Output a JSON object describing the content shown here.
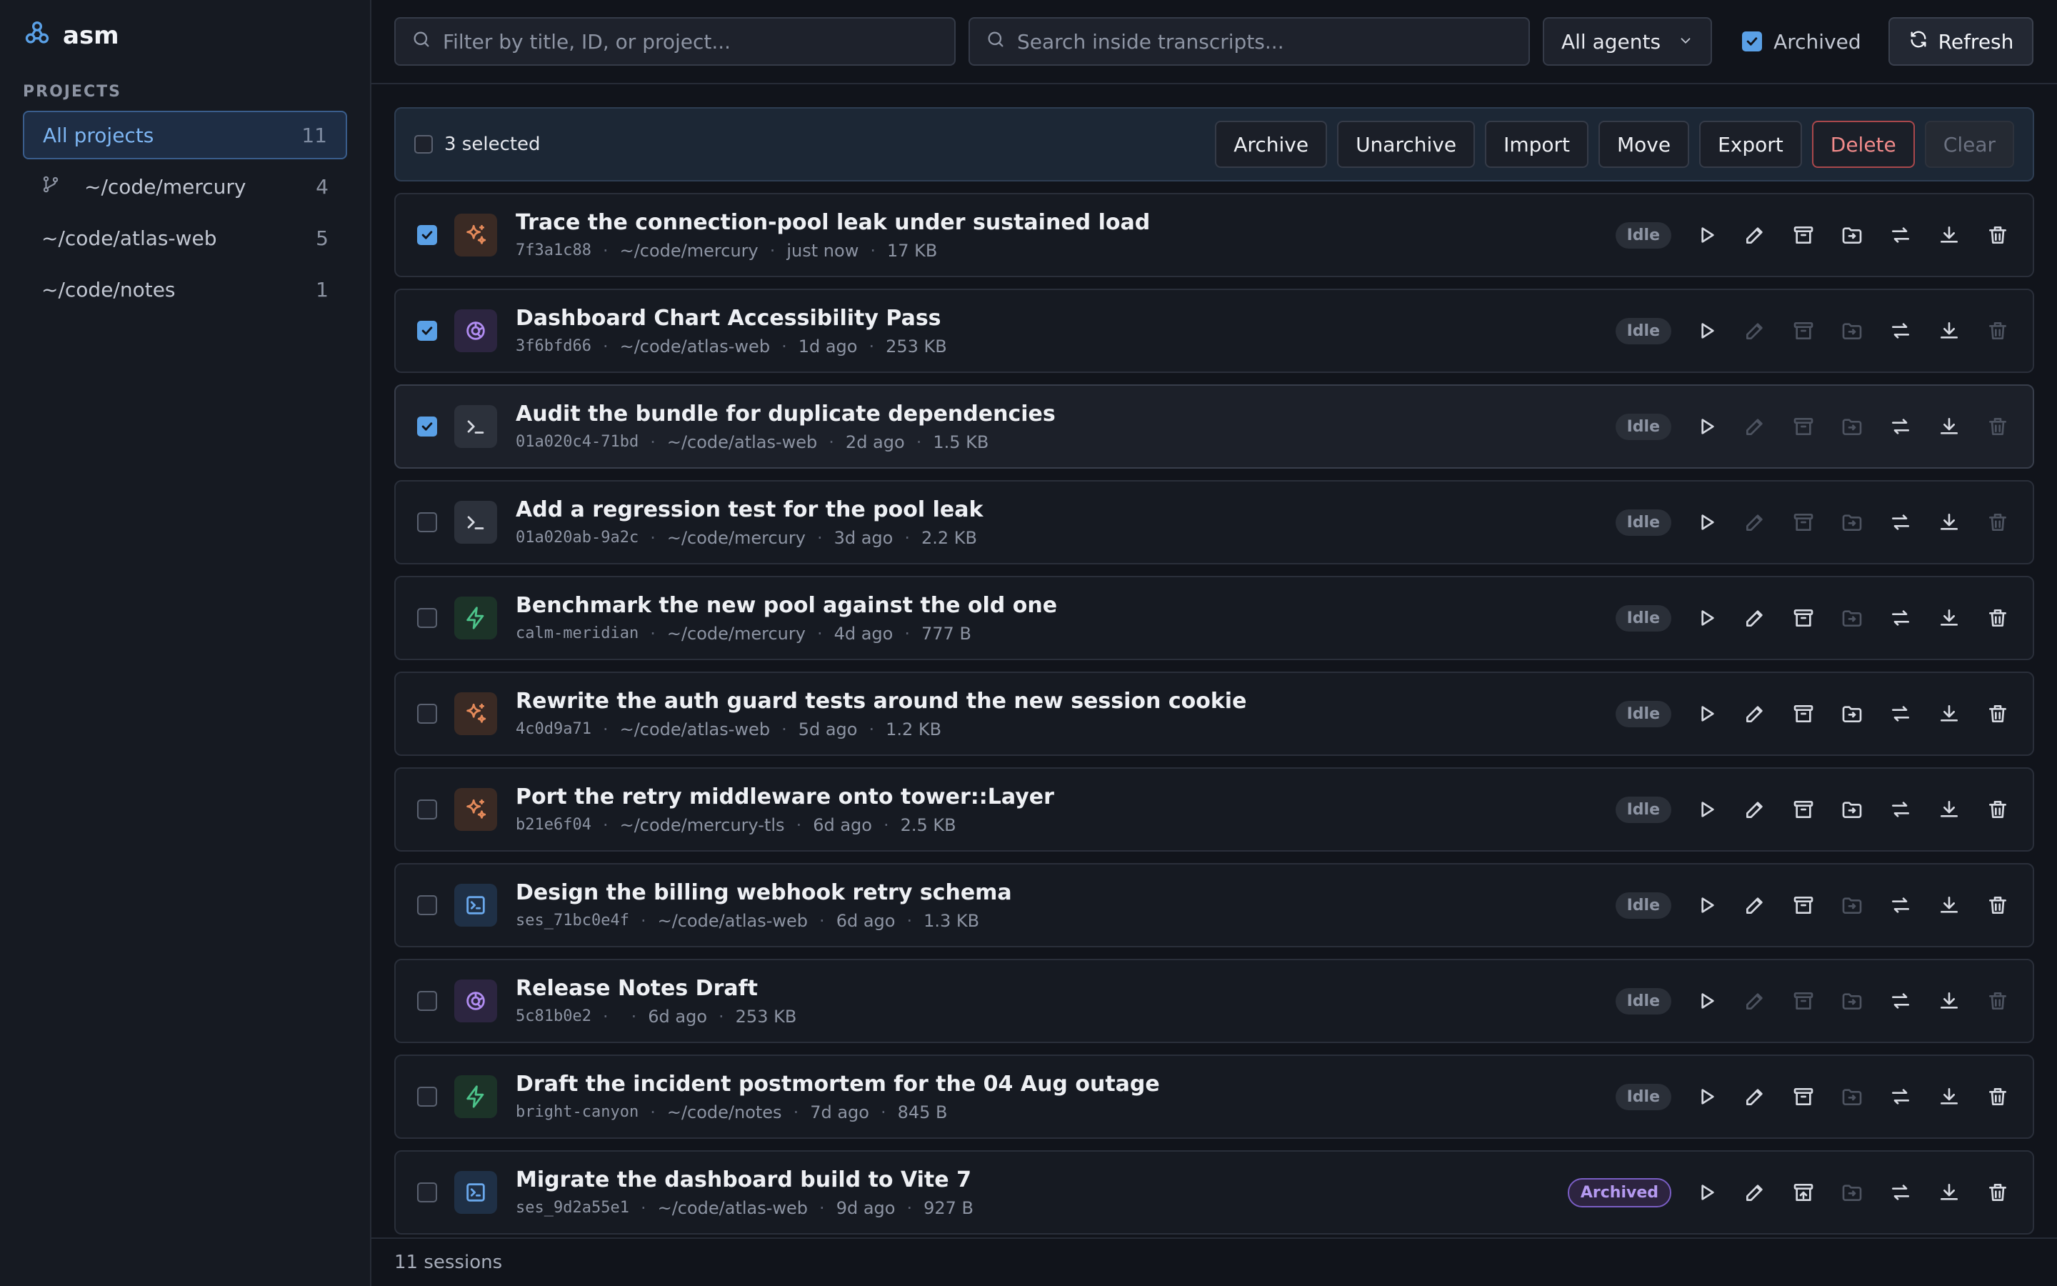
{
  "app": {
    "name": "asm"
  },
  "sidebar": {
    "section_label": "PROJECTS",
    "items": [
      {
        "label": "All projects",
        "count": "11",
        "active": true
      },
      {
        "label": "~/code/mercury",
        "count": "4",
        "icon": "git-branch-icon"
      },
      {
        "label": "~/code/atlas-web",
        "count": "5"
      },
      {
        "label": "~/code/notes",
        "count": "1"
      }
    ]
  },
  "toolbar": {
    "filter_placeholder": "Filter by title, ID, or project...",
    "search_placeholder": "Search inside transcripts...",
    "agent_select": "All agents",
    "archived_label": "Archived",
    "archived_checked": true,
    "refresh_label": "Refresh"
  },
  "selection": {
    "text": "3 selected",
    "actions": {
      "archive": "Archive",
      "unarchive": "Unarchive",
      "import": "Import",
      "move": "Move",
      "export": "Export",
      "delete": "Delete",
      "clear": "Clear"
    }
  },
  "sessions": [
    {
      "title": "Trace the connection-pool leak under sustained load",
      "id": "7f3a1c88",
      "project": "~/code/mercury",
      "age": "just now",
      "size": "17 KB",
      "status": "Idle",
      "agent": "claude",
      "selected": true,
      "dim": []
    },
    {
      "title": "Dashboard Chart Accessibility Pass",
      "id": "3f6bfd66",
      "project": "~/code/atlas-web",
      "age": "1d ago",
      "size": "253 KB",
      "status": "Idle",
      "agent": "openai",
      "selected": true,
      "dim": [
        "edit",
        "archive",
        "move",
        "delete"
      ]
    },
    {
      "title": "Audit the bundle for duplicate dependencies",
      "id": "01a020c4-71bd",
      "project": "~/code/atlas-web",
      "age": "2d ago",
      "size": "1.5 KB",
      "status": "Idle",
      "agent": "terminal",
      "selected": true,
      "highlight": true,
      "dim": [
        "edit",
        "archive",
        "move",
        "delete"
      ]
    },
    {
      "title": "Add a regression test for the pool leak",
      "id": "01a020ab-9a2c",
      "project": "~/code/mercury",
      "age": "3d ago",
      "size": "2.2 KB",
      "status": "Idle",
      "agent": "terminal",
      "selected": false,
      "dim": [
        "edit",
        "archive",
        "move",
        "delete"
      ]
    },
    {
      "title": "Benchmark the new pool against the old one",
      "id": "calm-meridian",
      "project": "~/code/mercury",
      "age": "4d ago",
      "size": "777 B",
      "status": "Idle",
      "agent": "bolt",
      "selected": false,
      "dim": [
        "move"
      ]
    },
    {
      "title": "Rewrite the auth guard tests around the new session cookie",
      "id": "4c0d9a71",
      "project": "~/code/atlas-web",
      "age": "5d ago",
      "size": "1.2 KB",
      "status": "Idle",
      "agent": "claude",
      "selected": false,
      "dim": []
    },
    {
      "title": "Port the retry middleware onto tower::Layer",
      "id": "b21e6f04",
      "project": "~/code/mercury-tls",
      "age": "6d ago",
      "size": "2.5 KB",
      "status": "Idle",
      "agent": "claude",
      "selected": false,
      "dim": []
    },
    {
      "title": "Design the billing webhook retry schema",
      "id": "ses_71bc0e4f",
      "project": "~/code/atlas-web",
      "age": "6d ago",
      "size": "1.3 KB",
      "status": "Idle",
      "agent": "box",
      "selected": false,
      "dim": [
        "move"
      ]
    },
    {
      "title": "Release Notes Draft",
      "id": "5c81b0e2",
      "project": "",
      "age": "6d ago",
      "size": "253 KB",
      "status": "Idle",
      "agent": "openai",
      "selected": false,
      "dim": [
        "edit",
        "archive",
        "move",
        "delete"
      ]
    },
    {
      "title": "Draft the incident postmortem for the 04 Aug outage",
      "id": "bright-canyon",
      "project": "~/code/notes",
      "age": "7d ago",
      "size": "845 B",
      "status": "Idle",
      "agent": "bolt",
      "selected": false,
      "dim": [
        "move"
      ]
    },
    {
      "title": "Migrate the dashboard build to Vite 7",
      "id": "ses_9d2a55e1",
      "project": "~/code/atlas-web",
      "age": "9d ago",
      "size": "927 B",
      "status": "Archived",
      "agent": "box",
      "selected": false,
      "dim": [
        "move"
      ]
    }
  ],
  "footer": {
    "text": "11 sessions"
  }
}
